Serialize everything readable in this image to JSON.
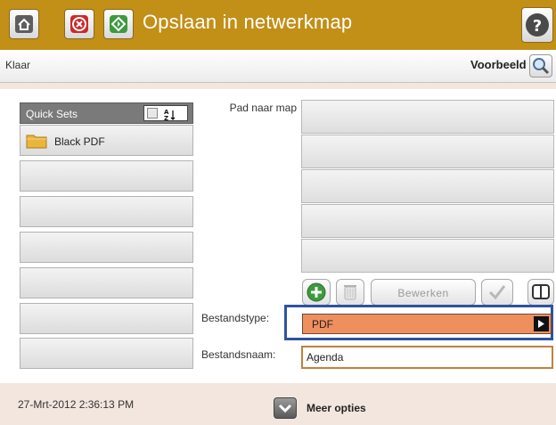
{
  "window": {
    "title": "Opslaan in netwerkmap"
  },
  "icons": {
    "home": "home-icon",
    "stop": "stop-icon",
    "start": "start-icon",
    "help": "help-icon",
    "preview": "magnifier-icon",
    "folder": "folder-icon",
    "add": "add-icon",
    "delete": "trash-icon",
    "check": "check-icon",
    "book": "address-book-icon",
    "more": "chevron-down-icon"
  },
  "status": {
    "text": "Klaar",
    "preview_label": "Voorbeeld"
  },
  "quick_sets": {
    "title": "Quick Sets",
    "sort_label": "A Z",
    "items": [
      {
        "label": "Black PDF"
      },
      {
        "label": ""
      },
      {
        "label": ""
      },
      {
        "label": ""
      },
      {
        "label": ""
      },
      {
        "label": ""
      },
      {
        "label": ""
      }
    ]
  },
  "folder_path": {
    "label": "Pad naar map",
    "rows": [
      "",
      "",
      "",
      "",
      ""
    ]
  },
  "actions": {
    "edit_label": "Bewerken"
  },
  "file_type": {
    "label": "Bestandstype:",
    "value": "PDF"
  },
  "file_name": {
    "label": "Bestandsnaam:",
    "value": "Agenda"
  },
  "footer": {
    "datetime": "27-Mrt-2012 2:36:13 PM",
    "more_label": "Meer opties"
  },
  "colors": {
    "title_bar": "#c28f17",
    "highlight": "#2e53a0",
    "dropdown": "#ef8f5e",
    "background": "#f3e6de"
  }
}
